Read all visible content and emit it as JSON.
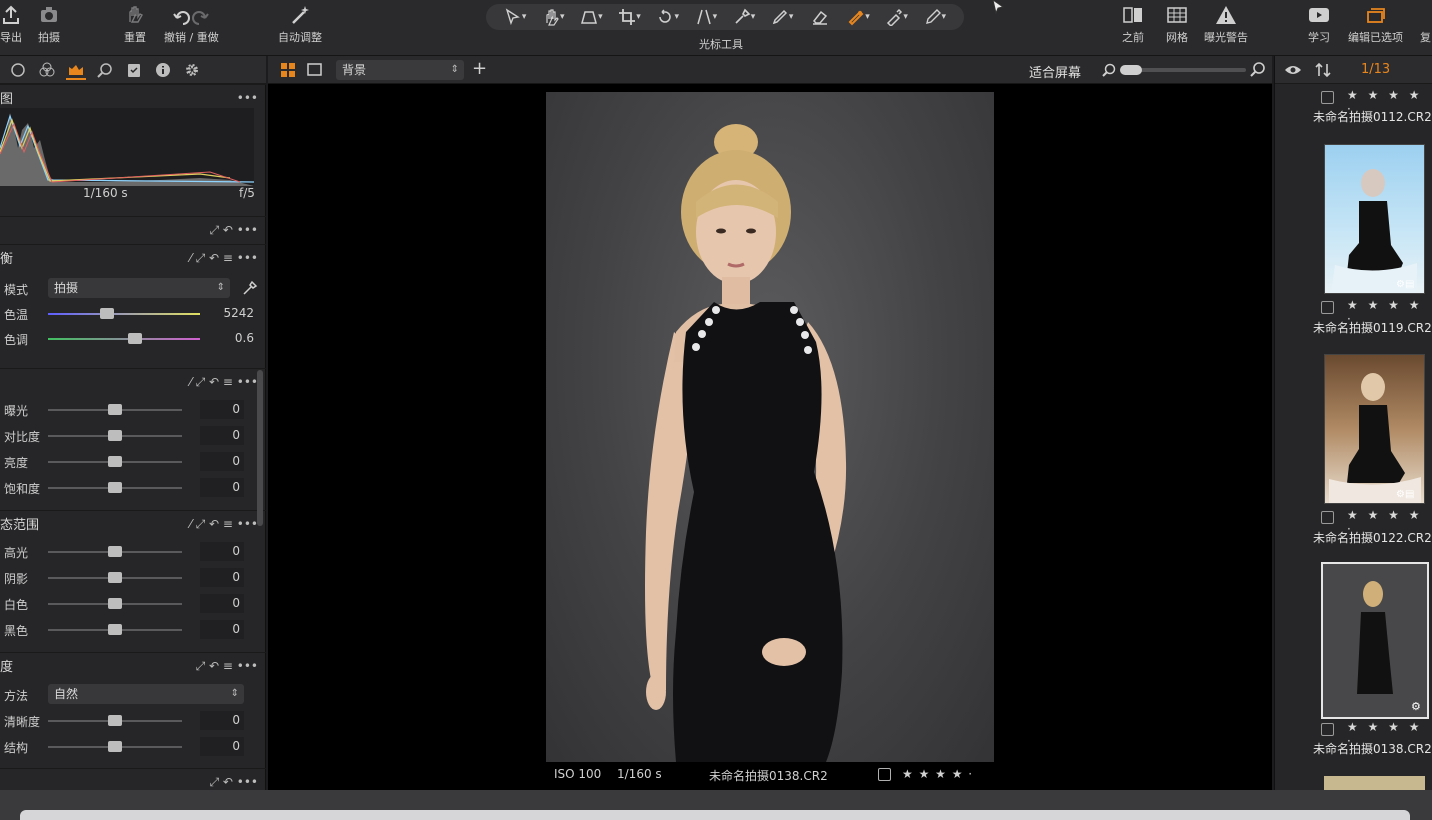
{
  "toolbar": {
    "left_buttons": [
      {
        "label": "导出",
        "icon": "export-icon"
      },
      {
        "label": "拍摄",
        "icon": "camera-icon"
      },
      {
        "label": "重置",
        "icon": "reset-hand-icon"
      },
      {
        "label": "撤销 / 重做",
        "icon": "undo-redo-icon"
      },
      {
        "label": "自动调整",
        "icon": "magic-wand-icon"
      }
    ],
    "cursor_tools_label": "光标工具",
    "right_buttons": [
      {
        "label": "之前",
        "icon": "before-after-icon"
      },
      {
        "label": "网格",
        "icon": "grid-icon"
      },
      {
        "label": "曝光警告",
        "icon": "warning-icon"
      },
      {
        "label": "学习",
        "icon": "play-icon"
      },
      {
        "label": "编辑已选项",
        "icon": "stack-icon"
      },
      {
        "label": "复",
        "icon": ""
      }
    ]
  },
  "left_panel": {
    "histogram": {
      "title": "图",
      "shutter": "1/160 s",
      "aperture": "f/5"
    },
    "white_balance": {
      "title": "衡",
      "mode_label": "模式",
      "mode_value": "拍摄",
      "temp_label": "色温",
      "temp_value": "5242",
      "temp_fraction": 0.39,
      "tint_label": "色调",
      "tint_value": "0.6",
      "tint_fraction": 0.57
    },
    "exposure": {
      "rows": [
        {
          "label": "曝光",
          "value": "0"
        },
        {
          "label": "对比度",
          "value": "0"
        },
        {
          "label": "亮度",
          "value": "0"
        },
        {
          "label": "饱和度",
          "value": "0"
        }
      ]
    },
    "hdr": {
      "title": "态范围",
      "rows": [
        {
          "label": "高光",
          "value": "0"
        },
        {
          "label": "阴影",
          "value": "0"
        },
        {
          "label": "白色",
          "value": "0"
        },
        {
          "label": "黑色",
          "value": "0"
        }
      ]
    },
    "clarity": {
      "title": "度",
      "method_label": "方法",
      "method_value": "自然",
      "rows": [
        {
          "label": "清晰度",
          "value": "0"
        },
        {
          "label": "结构",
          "value": "0"
        }
      ]
    }
  },
  "viewer": {
    "variant_select": "背景",
    "fit_label": "适合屏幕",
    "iso": "ISO 100",
    "shutter": "1/160 s",
    "filename": "未命名拍摄0138.CR2",
    "rating": "★ ★ ★ ★ ·"
  },
  "browser": {
    "count": "1/13",
    "items": [
      {
        "name": "未命名拍摄0112.CR2",
        "rating": "★ ★ ★ ★ ·"
      },
      {
        "name": "未命名拍摄0119.CR2",
        "rating": "★ ★ ★ ★ ·"
      },
      {
        "name": "未命名拍摄0122.CR2",
        "rating": "★ ★ ★ ★ ·"
      },
      {
        "name": "未命名拍摄0138.CR2",
        "rating": "★ ★ ★ ★ ·"
      }
    ]
  },
  "colors": {
    "accent": "#e8861e",
    "panel": "#262628",
    "warning": "#e05050"
  }
}
